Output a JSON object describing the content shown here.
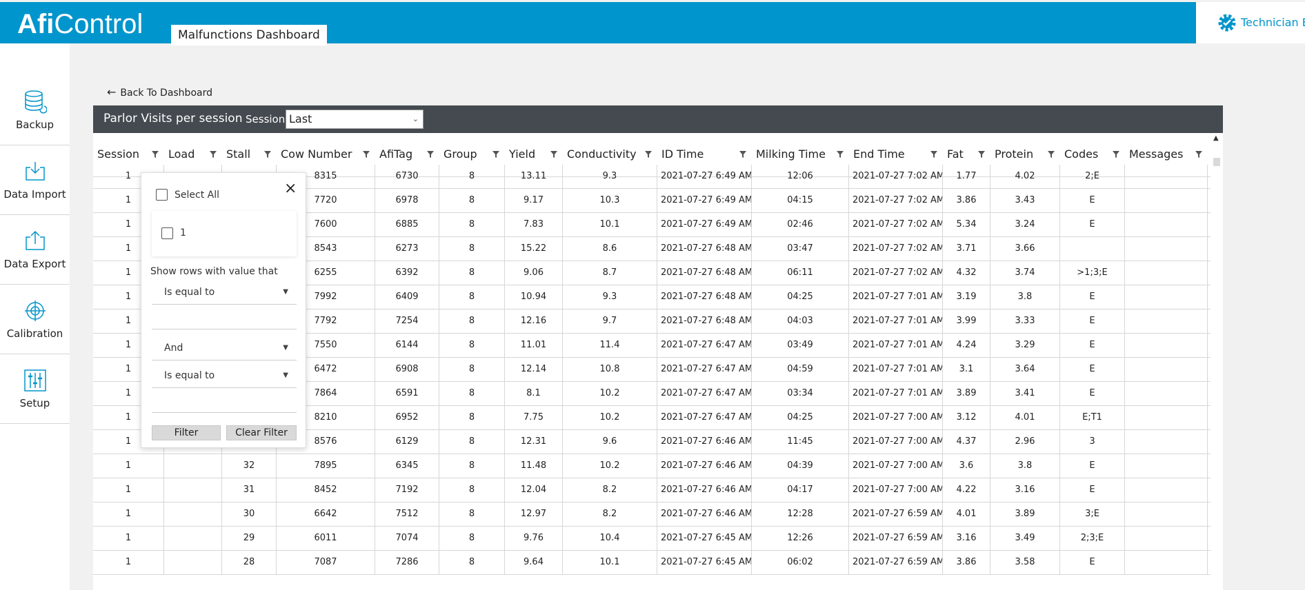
{
  "header": {
    "logo_bold": "Afi",
    "logo_light": "Control",
    "tab_label": "Malfunctions Dashboard",
    "user_label": "Technician En"
  },
  "sidebar": {
    "items": [
      {
        "label": "Backup",
        "icon": "database-icon"
      },
      {
        "label": "Data Import",
        "icon": "import-icon"
      },
      {
        "label": "Data Export",
        "icon": "export-icon"
      },
      {
        "label": "Calibration",
        "icon": "crosshair-icon"
      },
      {
        "label": "Setup",
        "icon": "sliders-icon"
      }
    ]
  },
  "main": {
    "back_label": "Back To Dashboard",
    "panel_title": "Parlor Visits per session",
    "session_label": "Session",
    "session_value": "Last"
  },
  "grid": {
    "columns": [
      "Session",
      "Load",
      "Stall",
      "Cow Number",
      "AfiTag",
      "Group",
      "Yield",
      "Conductivity",
      "ID Time",
      "Milking Time",
      "End Time",
      "Fat",
      "Protein",
      "Codes",
      "Messages"
    ],
    "rows": [
      [
        "1",
        "",
        "",
        "8315",
        "6730",
        "8",
        "13.11",
        "9.3",
        "2021-07-27 6:49 AM",
        "12:06",
        "2021-07-27 7:02 AM",
        "1.77",
        "4.02",
        "2;E",
        ""
      ],
      [
        "1",
        "",
        "",
        "7720",
        "6978",
        "8",
        "9.17",
        "10.3",
        "2021-07-27 6:49 AM",
        "04:15",
        "2021-07-27 7:02 AM",
        "3.86",
        "3.43",
        "E",
        ""
      ],
      [
        "1",
        "",
        "",
        "7600",
        "6885",
        "8",
        "7.83",
        "10.1",
        "2021-07-27 6:49 AM",
        "02:46",
        "2021-07-27 7:02 AM",
        "5.34",
        "3.24",
        "E",
        ""
      ],
      [
        "1",
        "",
        "",
        "8543",
        "6273",
        "8",
        "15.22",
        "8.6",
        "2021-07-27 6:48 AM",
        "03:47",
        "2021-07-27 7:02 AM",
        "3.71",
        "3.66",
        "",
        ""
      ],
      [
        "1",
        "",
        "",
        "6255",
        "6392",
        "8",
        "9.06",
        "8.7",
        "2021-07-27 6:48 AM",
        "06:11",
        "2021-07-27 7:02 AM",
        "4.32",
        "3.74",
        ">1;3;E",
        ""
      ],
      [
        "1",
        "",
        "",
        "7992",
        "6409",
        "8",
        "10.94",
        "9.3",
        "2021-07-27 6:48 AM",
        "04:25",
        "2021-07-27 7:01 AM",
        "3.19",
        "3.8",
        "E",
        ""
      ],
      [
        "1",
        "",
        "",
        "7792",
        "7254",
        "8",
        "12.16",
        "9.7",
        "2021-07-27 6:48 AM",
        "04:03",
        "2021-07-27 7:01 AM",
        "3.99",
        "3.33",
        "E",
        ""
      ],
      [
        "1",
        "",
        "",
        "7550",
        "6144",
        "8",
        "11.01",
        "11.4",
        "2021-07-27 6:47 AM",
        "03:49",
        "2021-07-27 7:01 AM",
        "4.24",
        "3.29",
        "E",
        ""
      ],
      [
        "1",
        "",
        "",
        "6472",
        "6908",
        "8",
        "12.14",
        "10.8",
        "2021-07-27 6:47 AM",
        "04:59",
        "2021-07-27 7:01 AM",
        "3.1",
        "3.64",
        "E",
        ""
      ],
      [
        "1",
        "",
        "",
        "7864",
        "6591",
        "8",
        "8.1",
        "10.2",
        "2021-07-27 6:47 AM",
        "03:34",
        "2021-07-27 7:01 AM",
        "3.89",
        "3.41",
        "E",
        ""
      ],
      [
        "1",
        "",
        "",
        "8210",
        "6952",
        "8",
        "7.75",
        "10.2",
        "2021-07-27 6:47 AM",
        "04:25",
        "2021-07-27 7:00 AM",
        "3.12",
        "4.01",
        "E;T1",
        ""
      ],
      [
        "1",
        "",
        "",
        "8576",
        "6129",
        "8",
        "12.31",
        "9.6",
        "2021-07-27 6:46 AM",
        "11:45",
        "2021-07-27 7:00 AM",
        "4.37",
        "2.96",
        "3",
        ""
      ],
      [
        "1",
        "",
        "32",
        "7895",
        "6345",
        "8",
        "11.48",
        "10.2",
        "2021-07-27 6:46 AM",
        "04:39",
        "2021-07-27 7:00 AM",
        "3.6",
        "3.8",
        "E",
        ""
      ],
      [
        "1",
        "",
        "31",
        "8452",
        "7192",
        "8",
        "12.04",
        "8.2",
        "2021-07-27 6:46 AM",
        "04:17",
        "2021-07-27 7:00 AM",
        "4.22",
        "3.16",
        "E",
        ""
      ],
      [
        "1",
        "",
        "30",
        "6642",
        "7512",
        "8",
        "12.97",
        "8.2",
        "2021-07-27 6:46 AM",
        "12:28",
        "2021-07-27 6:59 AM",
        "4.01",
        "3.89",
        "3;E",
        ""
      ],
      [
        "1",
        "",
        "29",
        "6011",
        "7074",
        "8",
        "9.76",
        "10.4",
        "2021-07-27 6:45 AM",
        "12:26",
        "2021-07-27 6:59 AM",
        "3.16",
        "3.49",
        "2;3;E",
        ""
      ],
      [
        "1",
        "",
        "28",
        "7087",
        "7286",
        "8",
        "9.64",
        "10.1",
        "2021-07-27 6:45 AM",
        "06:02",
        "2021-07-27 6:59 AM",
        "3.86",
        "3.58",
        "E",
        ""
      ]
    ]
  },
  "filter_popup": {
    "select_all_label": "Select All",
    "value_option": "1",
    "show_rows_label": "Show rows with value that",
    "operator1": "Is equal to",
    "logic": "And",
    "operator2": "Is equal to",
    "filter_button": "Filter",
    "clear_button": "Clear Filter"
  },
  "colors": {
    "header_blue": "#0095cc",
    "panel_dark": "#444a50"
  }
}
